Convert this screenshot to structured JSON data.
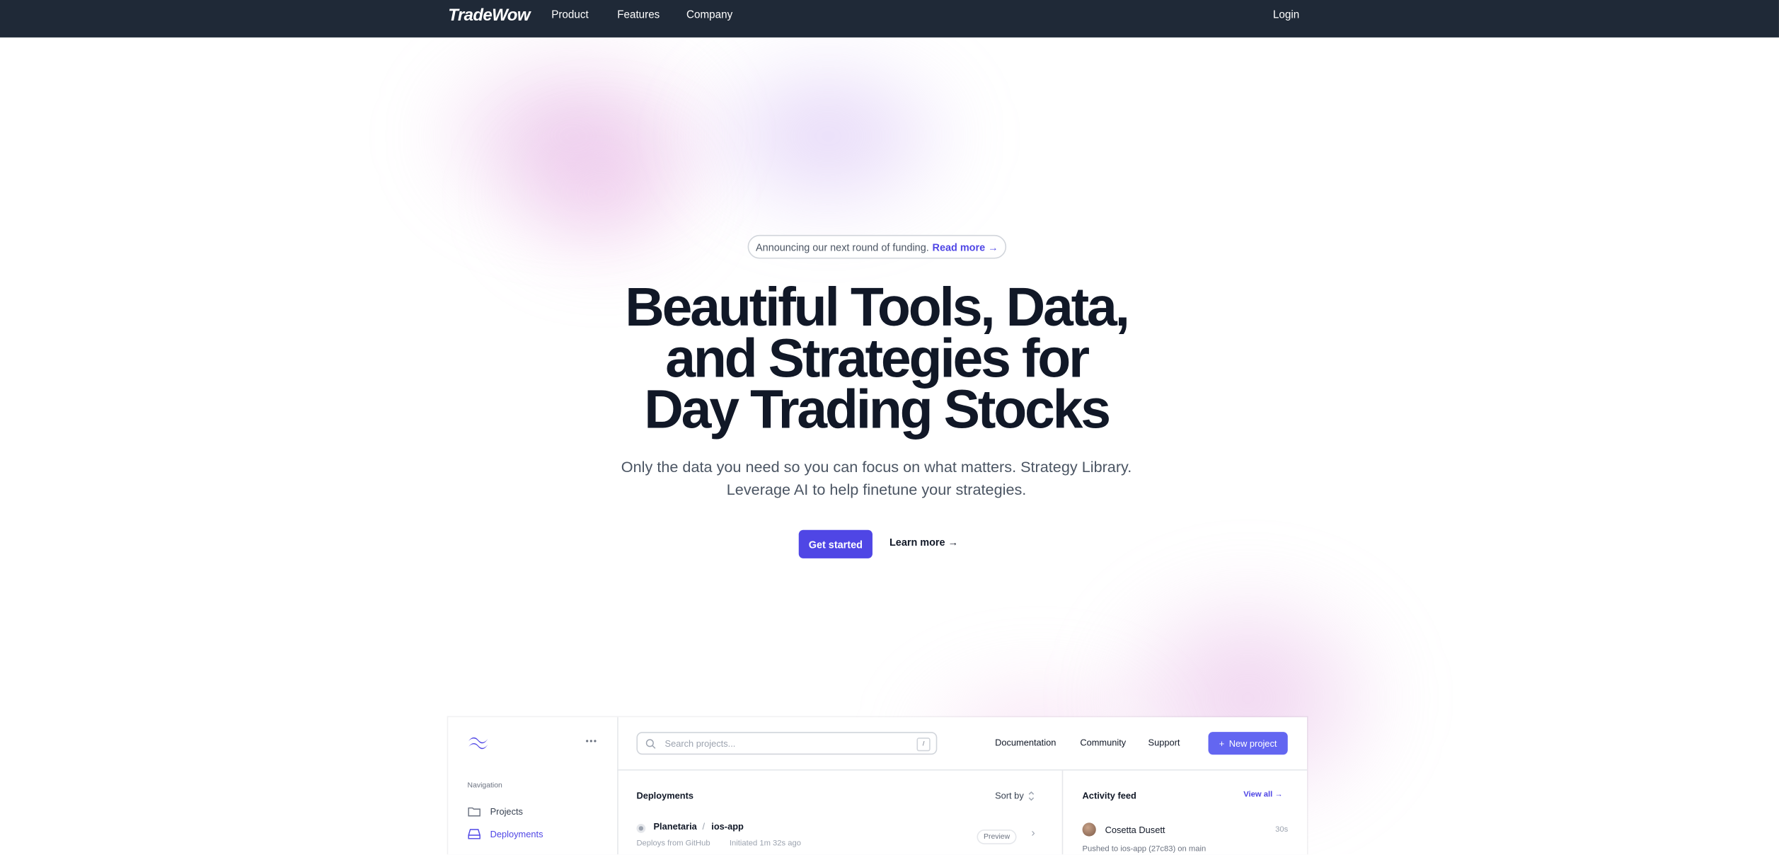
{
  "nav": {
    "logo": "TradeWow",
    "links": [
      "Product",
      "Features",
      "Company"
    ],
    "login": "Login"
  },
  "hero": {
    "announcement": "Announcing our next round of funding.",
    "announcement_link": "Read more",
    "headline_lines": [
      "Beautiful Tools, Data,",
      "and Strategies for",
      "Day Trading Stocks"
    ],
    "subtitle_lines": [
      "Only the data you need so you can focus on what matters. Strategy Library.",
      "Leverage AI to help finetune your strategies."
    ],
    "cta_primary": "Get started",
    "cta_secondary": "Learn more"
  },
  "app": {
    "search_placeholder": "Search projects...",
    "search_shortcut": "/",
    "top_links": [
      "Documentation",
      "Community",
      "Support"
    ],
    "new_project": "New project",
    "nav_label": "Navigation",
    "nav_items": [
      "Projects",
      "Deployments"
    ],
    "deployments": {
      "title": "Deployments",
      "sort": "Sort by",
      "row": {
        "org": "Planetaria",
        "separator": "/",
        "project": "ios-app",
        "desc": "Deploys from GitHub",
        "time": "Initiated 1m 32s ago",
        "badge": "Preview"
      }
    },
    "activity": {
      "title": "Activity feed",
      "view_all": "View all",
      "entry": {
        "name": "Cosetta Dusett",
        "time": "30s",
        "detail": "Pushed to ios-app (27c83) on main"
      }
    }
  },
  "colors": {
    "nav_bg": "#1f2937",
    "accent": "#4f46e5",
    "accent_light": "#6366f1"
  }
}
